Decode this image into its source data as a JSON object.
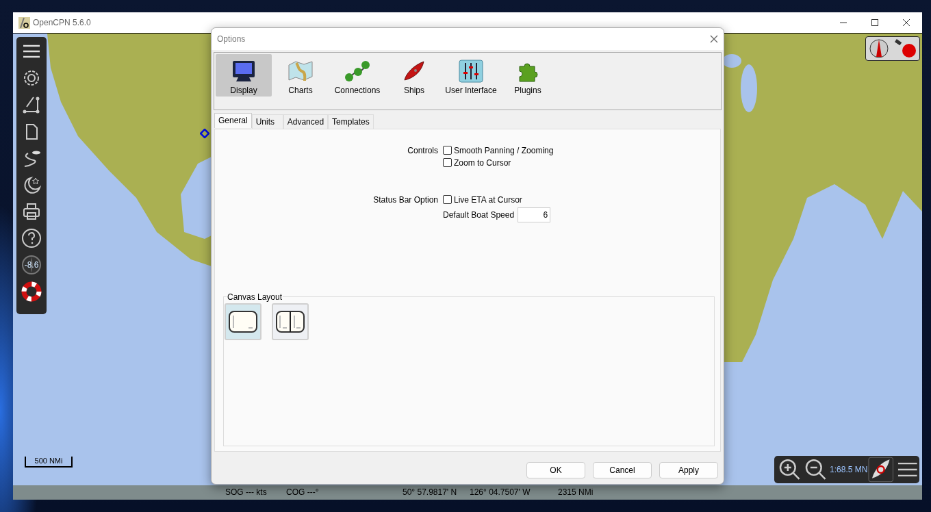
{
  "window": {
    "title": "OpenCPN 5.6.0"
  },
  "toolbar": {
    "variation": "-8.6"
  },
  "scale_bar": {
    "label": "500 NMi"
  },
  "zoom_bar": {
    "scale": "1:68.5 MN"
  },
  "status_bar": {
    "sog": "SOG --- kts",
    "cog": "COG ---°",
    "latitude": "50° 57.9817' N",
    "longitude": "126° 04.7507' W",
    "distance": "2315 NMi"
  },
  "dialog": {
    "title": "Options",
    "categories": [
      {
        "label": "Display",
        "kind": "display",
        "selected": true
      },
      {
        "label": "Charts",
        "kind": "charts",
        "selected": false
      },
      {
        "label": "Connections",
        "kind": "connections",
        "selected": false
      },
      {
        "label": "Ships",
        "kind": "ships",
        "selected": false
      },
      {
        "label": "User Interface",
        "kind": "interface",
        "selected": false
      },
      {
        "label": "Plugins",
        "kind": "plugins",
        "selected": false
      }
    ],
    "tabs": [
      {
        "label": "General",
        "selected": true
      },
      {
        "label": "Units",
        "selected": false
      },
      {
        "label": "Advanced",
        "selected": false
      },
      {
        "label": "Templates",
        "selected": false
      }
    ],
    "settings": [
      {
        "label": "Controls",
        "options": [
          {
            "label": "Smooth Panning / Zooming",
            "checked": false
          },
          {
            "label": "Zoom to Cursor",
            "checked": false
          }
        ]
      },
      {
        "label": "Status Bar Option",
        "options": [
          {
            "label": "Live ETA at Cursor",
            "checked": false
          }
        ],
        "field": {
          "label": "Default Boat Speed",
          "value": "6"
        }
      }
    ],
    "canvas_layout": {
      "title": "Canvas Layout",
      "options": [
        {
          "kind": "single",
          "selected": true
        },
        {
          "kind": "split",
          "selected": false
        }
      ]
    },
    "buttons": [
      "OK",
      "Cancel",
      "Apply"
    ]
  }
}
